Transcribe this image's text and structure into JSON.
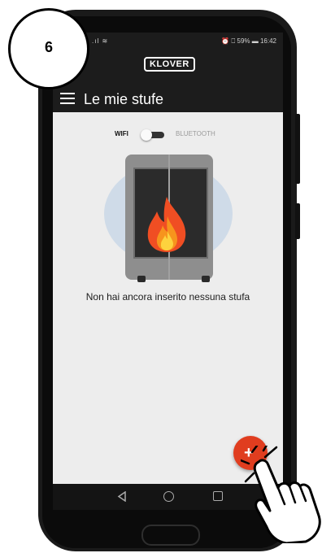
{
  "step_badge": {
    "number": "6"
  },
  "status_bar": {
    "left": ".ıl ≋",
    "right": "⏰ ⎕ 59% ▬ 16:42"
  },
  "brand": {
    "logo": "KLOVER"
  },
  "app_bar": {
    "title": "Le mie stufe"
  },
  "connection_toggle": {
    "left_label": "WIFI",
    "right_label": "BLUETOOTH",
    "selected": "WIFI"
  },
  "empty_state": {
    "message": "Non hai ancora inserito nessuna stufa"
  },
  "fab": {
    "label": "+"
  },
  "navigation": {
    "back": "◁"
  },
  "colors": {
    "accent": "#e03d1f",
    "appbar": "#1c1c1c",
    "background": "#ededed"
  },
  "icons": [
    "menu-icon",
    "stove-icon",
    "flame-icon",
    "add-icon",
    "back-icon",
    "home-icon",
    "recent-apps-icon",
    "hand-cursor-icon"
  ]
}
